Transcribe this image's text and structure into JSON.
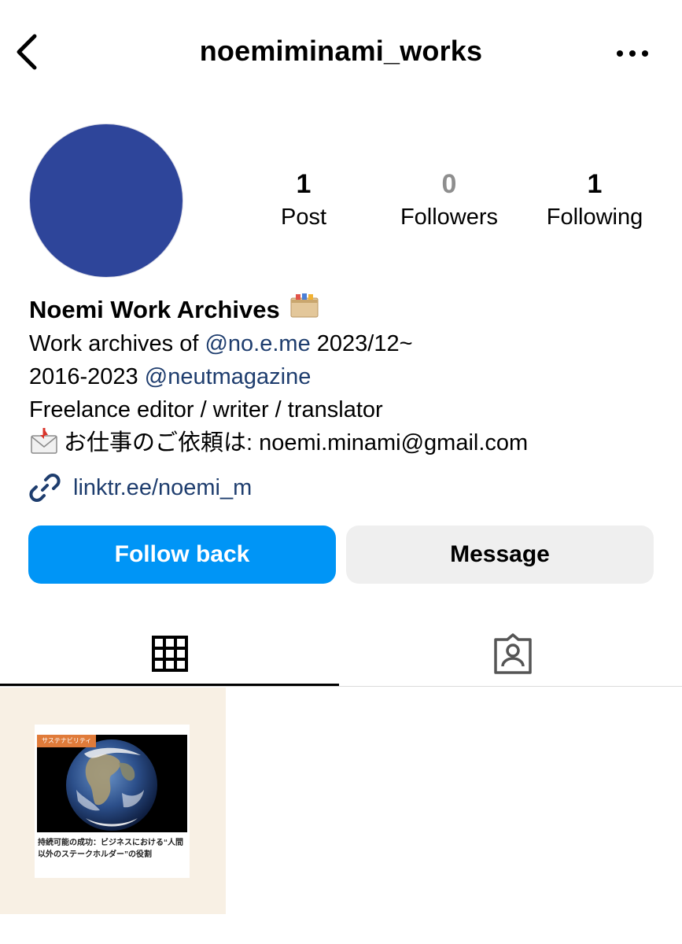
{
  "header": {
    "username": "noemiminami_works",
    "back_icon": "chevron-left-icon",
    "more_icon": "more-horizontal-icon"
  },
  "profile": {
    "avatar_color": "#2e459a",
    "stats": {
      "posts": {
        "count": "1",
        "label": "Post"
      },
      "followers": {
        "count": "0",
        "label": "Followers"
      },
      "following": {
        "count": "1",
        "label": "Following"
      }
    }
  },
  "bio": {
    "name": "Noemi Work Archives",
    "name_emoji": "card-index-dividers-emoji",
    "line1_text": "Work archives of ",
    "line1_mention": "@no.e.me",
    "line1_suffix": " 2023/12~",
    "line2_text": "2016-2023 ",
    "line2_mention": "@neutmagazine",
    "line3_text": "Freelance editor / writer / translator",
    "line4_emoji": "incoming-envelope-emoji",
    "line4_text": "お仕事のご依頼は: noemi.minami@gmail.com",
    "link_icon": "link-icon",
    "link_text": "linktr.ee/noemi_m"
  },
  "actions": {
    "follow_back_label": "Follow back",
    "message_label": "Message"
  },
  "tabs": [
    {
      "name": "posts-grid",
      "icon": "grid-icon",
      "active": true
    },
    {
      "name": "tagged",
      "icon": "tagged-person-icon",
      "active": false
    }
  ],
  "posts": [
    {
      "category_tag": "サステナビリティ",
      "caption": "持続可能の成功：ビジネスにおける“人間以外のステークホルダー”の役割",
      "image": "earth-photo"
    }
  ],
  "colors": {
    "accent_blue": "#0095f6",
    "mention_blue": "#1e3d6e",
    "secondary_button": "#efefef",
    "post_tile_bg": "#f8f0e4",
    "tag_orange": "#e07b3a"
  }
}
